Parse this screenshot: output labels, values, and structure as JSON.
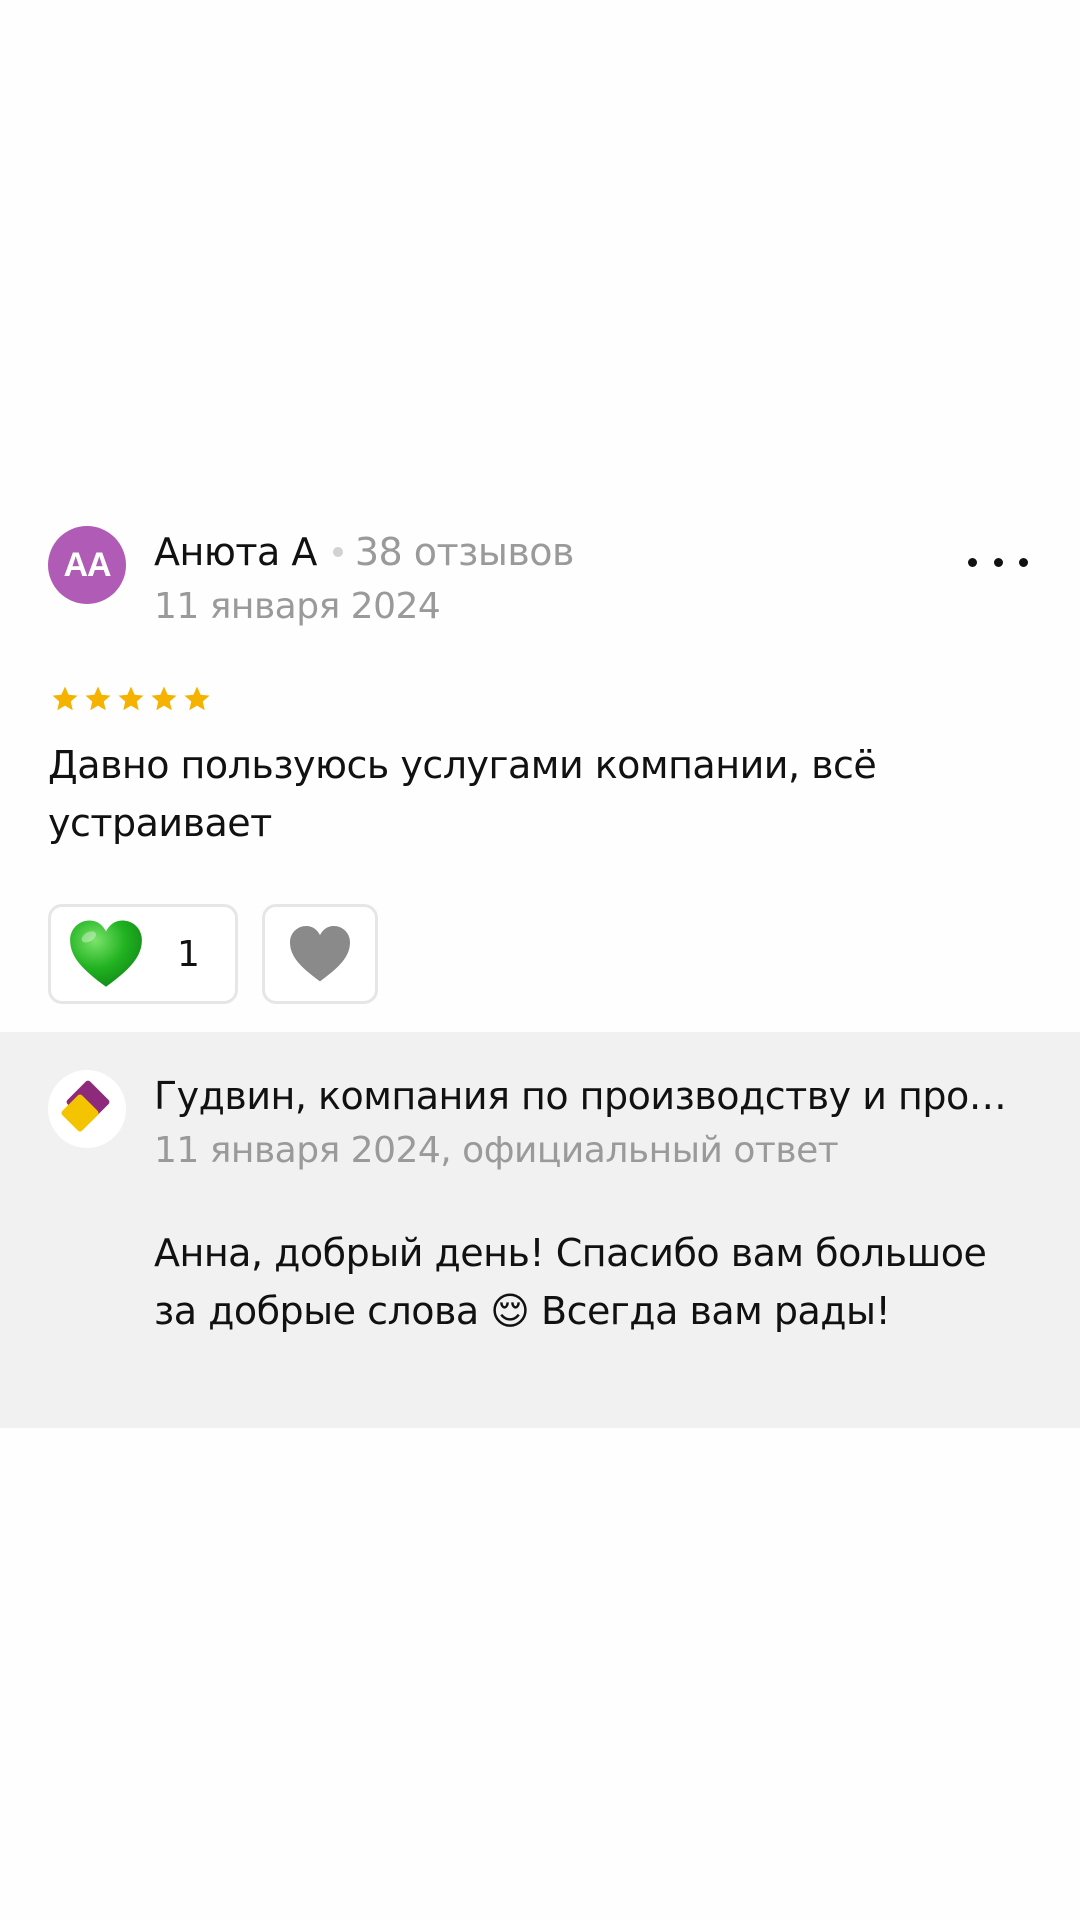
{
  "review": {
    "author_initials": "АА",
    "author_name": "Анюта А",
    "review_count": "38 отзывов",
    "date": "11 января 2024",
    "rating": 5,
    "rating_max": 5,
    "text": "Давно пользуюсь услугами компании, всё устраивает",
    "likes": "1",
    "icons": {
      "more": "more-options-icon",
      "like": "green-heart-icon",
      "dislike": "gray-heart-icon",
      "star": "star-icon"
    },
    "colors": {
      "avatar": "#b05bb5",
      "star": "#f5b300",
      "like_heart": "#2db82d",
      "dislike_heart": "#8a8a8a"
    }
  },
  "reply": {
    "company_name": "Гудвин, компания по производству и продаже изделий",
    "meta": "11 января 2024, официальный ответ",
    "text": "Анна, добрый день! Спасибо вам большое за добрые слова 😌 Всегда вам рады!",
    "icons": {
      "logo": "company-logo-icon"
    },
    "colors": {
      "background": "#f1f1f1",
      "logo_purple": "#8e2a7a",
      "logo_yellow": "#f5c400"
    }
  }
}
